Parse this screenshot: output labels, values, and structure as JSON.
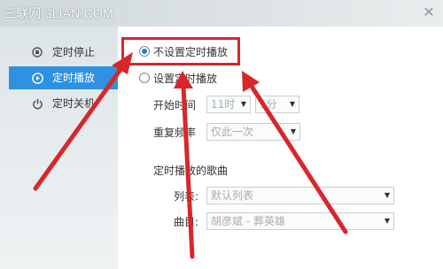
{
  "window": {
    "title": "三联网 3LIAN.COM",
    "close_glyph": "✕"
  },
  "sidebar": {
    "items": [
      {
        "label": "定时停止",
        "icon": "stop-circle-icon"
      },
      {
        "label": "定时播放",
        "icon": "play-circle-icon",
        "active": true
      },
      {
        "label": "定时关机",
        "icon": "power-icon"
      }
    ]
  },
  "options": {
    "no_schedule_label": "不设置定时播放",
    "set_schedule_label": "设置定时播放",
    "selected": "no_schedule"
  },
  "start_time": {
    "label": "开始时间",
    "hour": "11时",
    "minute": "1分"
  },
  "repeat": {
    "label": "重复频率",
    "value": "仅此一次"
  },
  "songs": {
    "heading": "定时播放的歌曲",
    "list_label": "列表:",
    "list_value": "默认列表",
    "song_label": "曲目:",
    "song_value": "胡彦斌 - 葬英雄"
  },
  "colors": {
    "accent": "#2f92e0",
    "annotation": "#d9262a"
  }
}
